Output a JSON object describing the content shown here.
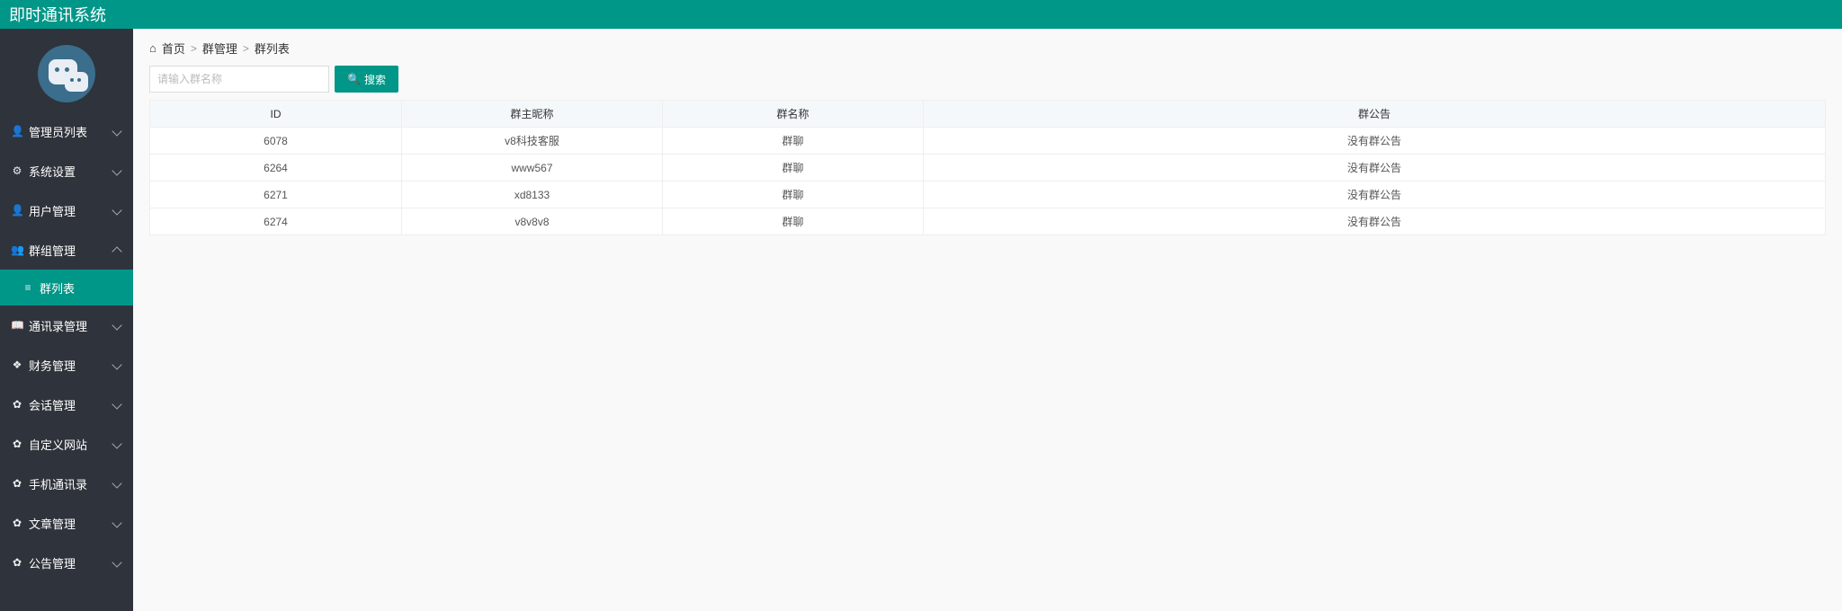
{
  "app_title": "即时通讯系统",
  "breadcrumb": {
    "home": "首页",
    "mid": "群管理",
    "current": "群列表"
  },
  "sidebar": {
    "items": [
      {
        "icon": "👤",
        "label": "管理员列表",
        "expanded": false
      },
      {
        "icon": "⚙",
        "label": "系统设置",
        "expanded": false
      },
      {
        "icon": "👤",
        "label": "用户管理",
        "expanded": false
      },
      {
        "icon": "👥",
        "label": "群组管理",
        "expanded": true,
        "children": [
          {
            "icon": "≡",
            "label": "群列表"
          }
        ]
      },
      {
        "icon": "📖",
        "label": "通讯录管理",
        "expanded": false
      },
      {
        "icon": "❖",
        "label": "财务管理",
        "expanded": false
      },
      {
        "icon": "✿",
        "label": "会话管理",
        "expanded": false
      },
      {
        "icon": "✿",
        "label": "自定义网站",
        "expanded": false
      },
      {
        "icon": "✿",
        "label": "手机通讯录",
        "expanded": false
      },
      {
        "icon": "✿",
        "label": "文章管理",
        "expanded": false
      },
      {
        "icon": "✿",
        "label": "公告管理",
        "expanded": false
      }
    ]
  },
  "search": {
    "placeholder": "请输入群名称",
    "button": "搜索"
  },
  "table": {
    "columns": [
      "ID",
      "群主昵称",
      "群名称",
      "群公告"
    ],
    "rows": [
      {
        "id": "6078",
        "owner": "v8科技客服",
        "name": "群聊",
        "notice": "没有群公告"
      },
      {
        "id": "6264",
        "owner": "www567",
        "name": "群聊",
        "notice": "没有群公告"
      },
      {
        "id": "6271",
        "owner": "xd8133",
        "name": "群聊",
        "notice": "没有群公告"
      },
      {
        "id": "6274",
        "owner": "v8v8v8",
        "name": "群聊",
        "notice": "没有群公告"
      }
    ]
  }
}
